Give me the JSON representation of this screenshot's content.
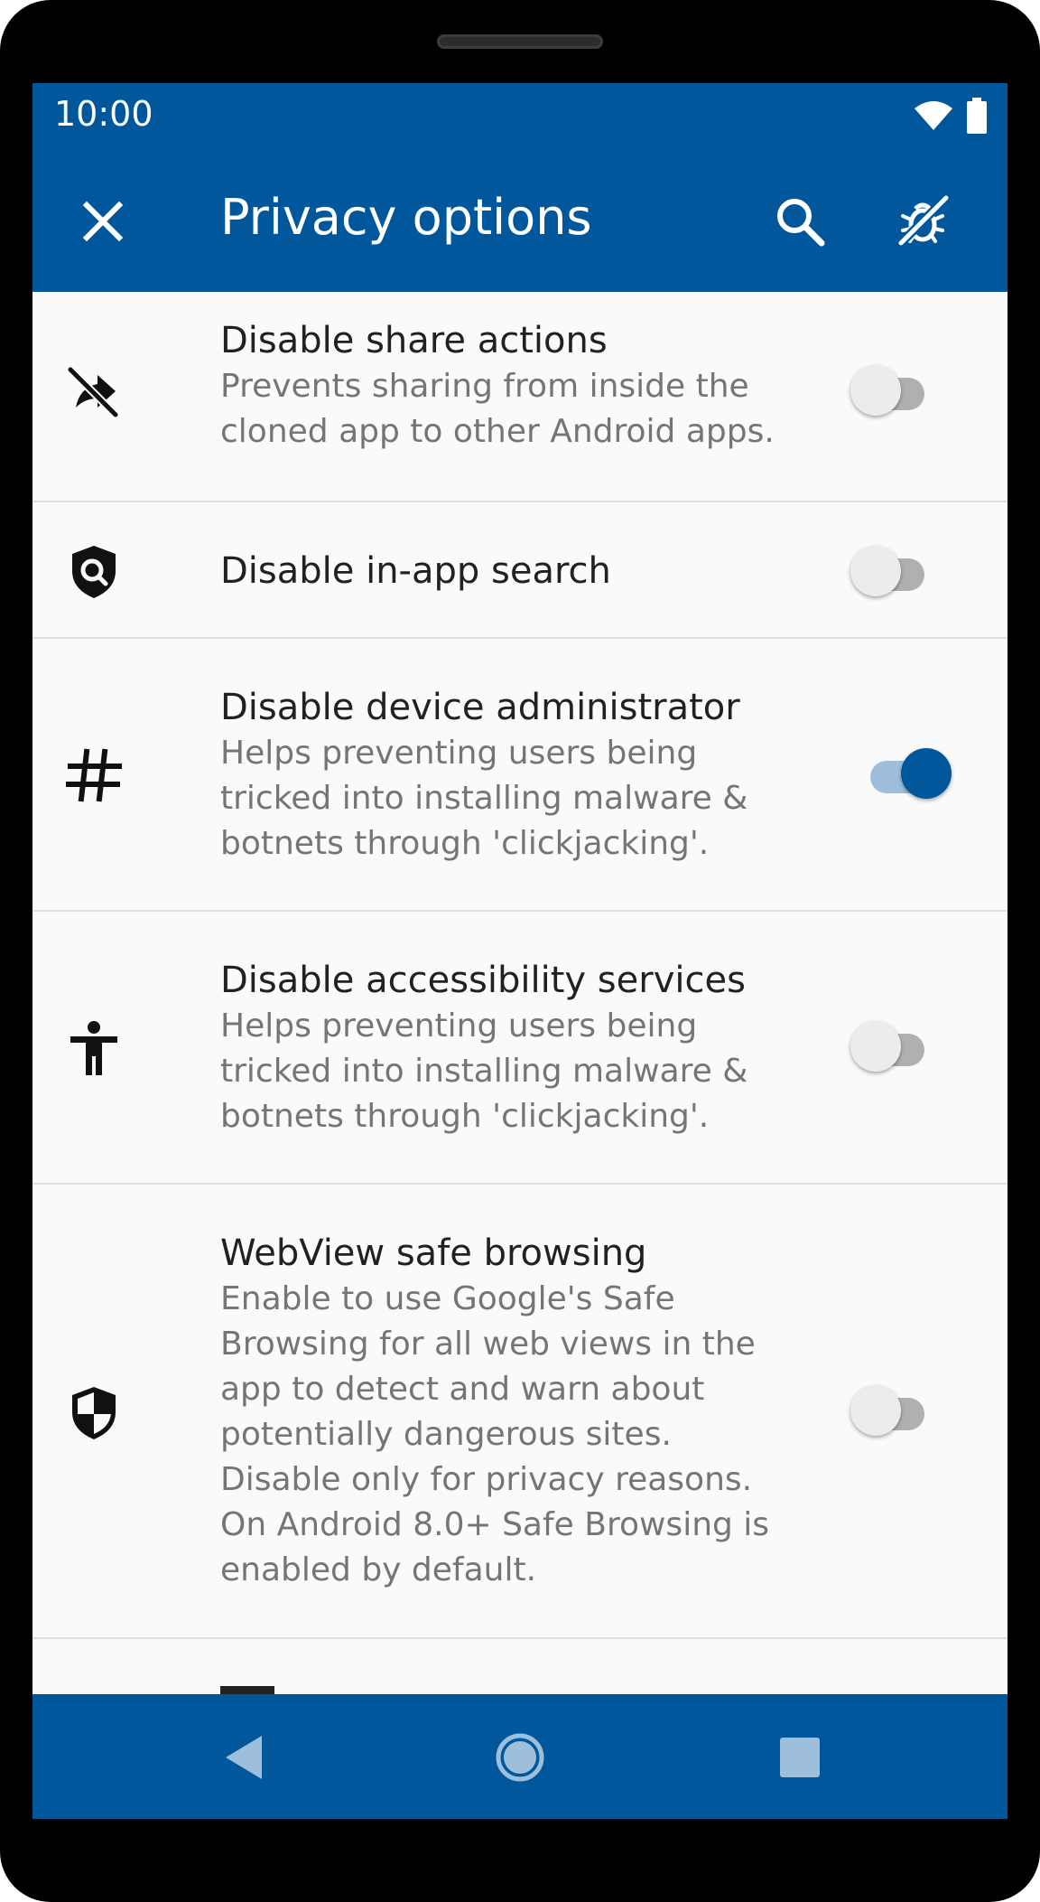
{
  "status": {
    "time": "10:00",
    "icons": [
      "wifi-icon",
      "battery-icon"
    ]
  },
  "toolbar": {
    "title": "Privacy options",
    "close_icon": "close-icon",
    "search_icon": "search-icon",
    "action_icon": "bug-off-icon"
  },
  "items": [
    {
      "icon": "share-off-icon",
      "title": "Disable share actions",
      "summary": "Prevents sharing from inside the cloned app to other Android apps.",
      "enabled": false
    },
    {
      "icon": "shield-search-icon",
      "title": "Disable in-app search",
      "summary": "",
      "enabled": false
    },
    {
      "icon": "hash-icon",
      "title": "Disable device administrator",
      "summary": "Helps preventing users being tricked into installing malware & botnets through 'clickjacking'.",
      "enabled": true
    },
    {
      "icon": "accessibility-icon",
      "title": "Disable accessibility services",
      "summary": "Helps preventing users being tricked into installing malware & botnets through 'clickjacking'.",
      "enabled": false
    },
    {
      "icon": "shield-half-icon",
      "title": "WebView safe browsing",
      "summary": "Enable to use Google's Safe Browsing for all web views in the app to detect and warn about potentially dangerous sites. Disable only for privacy reasons. On Android 8.0+ Safe Browsing is enabled by default.",
      "enabled": false
    }
  ],
  "navbar": {
    "back_icon": "back-triangle-icon",
    "home_icon": "home-circle-icon",
    "recents_icon": "recents-square-icon"
  },
  "colors": {
    "primary": "#01579b",
    "switch_on_track": "#9ebfdc",
    "background": "#fafafa"
  }
}
